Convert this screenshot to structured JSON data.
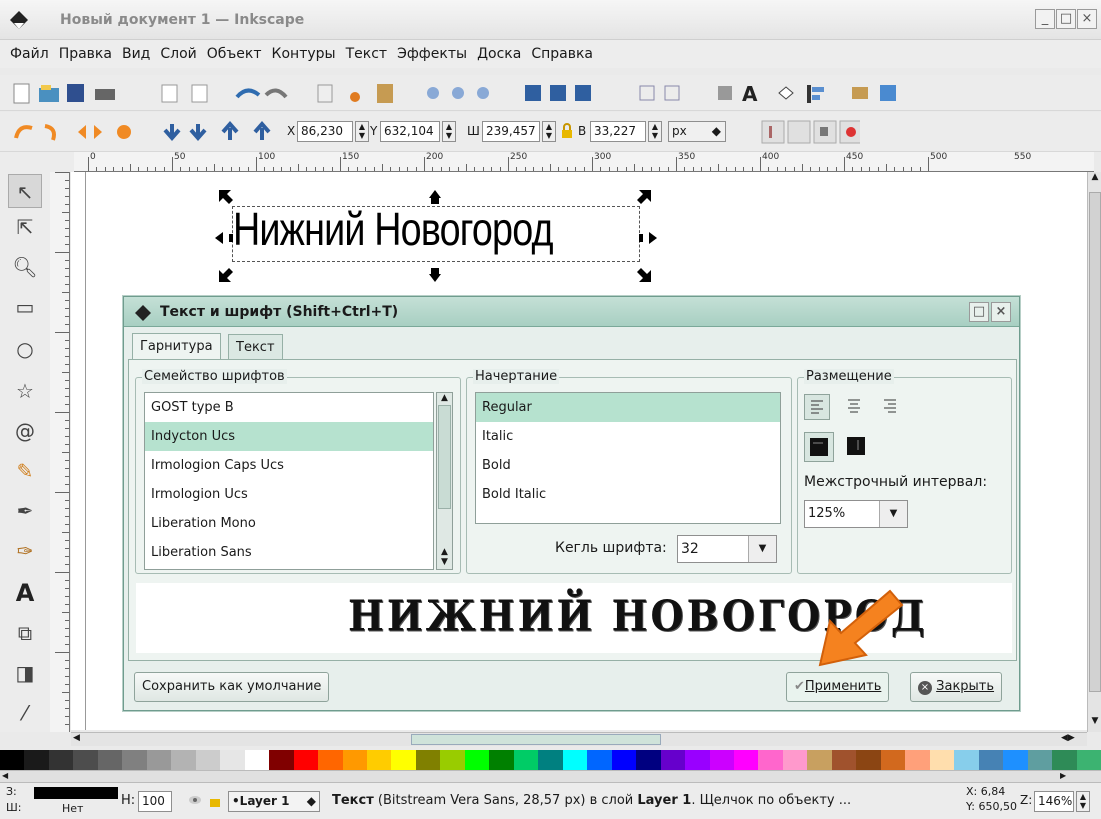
{
  "window": {
    "title": "Новый документ 1 — Inkscape",
    "app_icon": "inkscape-icon"
  },
  "menu": [
    "Файл",
    "Правка",
    "Вид",
    "Слой",
    "Объект",
    "Контуры",
    "Текст",
    "Эффекты",
    "Доска",
    "Справка"
  ],
  "tool_controls": {
    "x_label": "X",
    "x_value": "86,230",
    "y_label": "Y",
    "y_value": "632,104",
    "w_label": "Ш",
    "w_value": "239,457",
    "h_label": "В",
    "h_value": "33,227",
    "unit": "px"
  },
  "ruler_labels": [
    "0",
    "50",
    "100",
    "150",
    "200",
    "250",
    "300",
    "350",
    "400",
    "450",
    "500",
    "550"
  ],
  "canvas": {
    "text_object": "Нижний Новогород"
  },
  "dialog": {
    "title": "Текст и шрифт (Shift+Ctrl+T)",
    "tabs": [
      "Гарнитура",
      "Текст"
    ],
    "font_family_legend": "Семейство шрифтов",
    "font_families": [
      "GOST type B",
      "Indycton Ucs",
      "Irmologion Caps Ucs",
      "Irmologion Ucs",
      "Liberation Mono",
      "Liberation Sans"
    ],
    "selected_family": "Indycton Ucs",
    "style_legend": "Начертание",
    "styles": [
      "Regular",
      "Italic",
      "Bold",
      "Bold Italic"
    ],
    "selected_style": "Regular",
    "size_label": "Кегль шрифта:",
    "size_value": "32",
    "layout_legend": "Размещение",
    "line_spacing_label": "Межстрочный интервал:",
    "line_spacing_value": "125%",
    "preview_text": "НИЖНИЙ НОВОГОРОД",
    "set_default_button": "Сохранить как умолчание",
    "apply_button": "Применить",
    "close_button": "Закрыть"
  },
  "palette_colors": [
    "#000000",
    "#1a1a1a",
    "#333333",
    "#4d4d4d",
    "#666666",
    "#808080",
    "#999999",
    "#b3b3b3",
    "#cccccc",
    "#e6e6e6",
    "#ffffff",
    "#800000",
    "#ff0000",
    "#ff6600",
    "#ff9900",
    "#ffcc00",
    "#ffff00",
    "#808000",
    "#99cc00",
    "#00ff00",
    "#008000",
    "#00cc66",
    "#008080",
    "#00ffff",
    "#0066ff",
    "#0000ff",
    "#000080",
    "#6600cc",
    "#9900ff",
    "#cc00ff",
    "#ff00ff",
    "#ff66cc",
    "#ff99cc",
    "#c8a060",
    "#a0522d",
    "#8b4513",
    "#d2691e",
    "#ffa07a",
    "#ffdead",
    "#87ceeb",
    "#4682b4",
    "#1e90ff",
    "#5f9ea0",
    "#2e8b57",
    "#3cb371"
  ],
  "status": {
    "fill_label": "З:",
    "stroke_label": "Ш:",
    "stroke_value": "Нет",
    "opacity_label": "Н:",
    "opacity_value": "100",
    "layer": "•Layer 1",
    "message_bold": "Текст",
    "message_rest": " (Bitstream Vera Sans, 28,57 px) в слой ",
    "message_layer": "Layer 1",
    "message_tail": ". Щелчок по объекту ...",
    "x_coord": "X:  6,84",
    "y_coord": "Y: 650,50",
    "zoom_label": "Z:",
    "zoom_value": "146%"
  }
}
